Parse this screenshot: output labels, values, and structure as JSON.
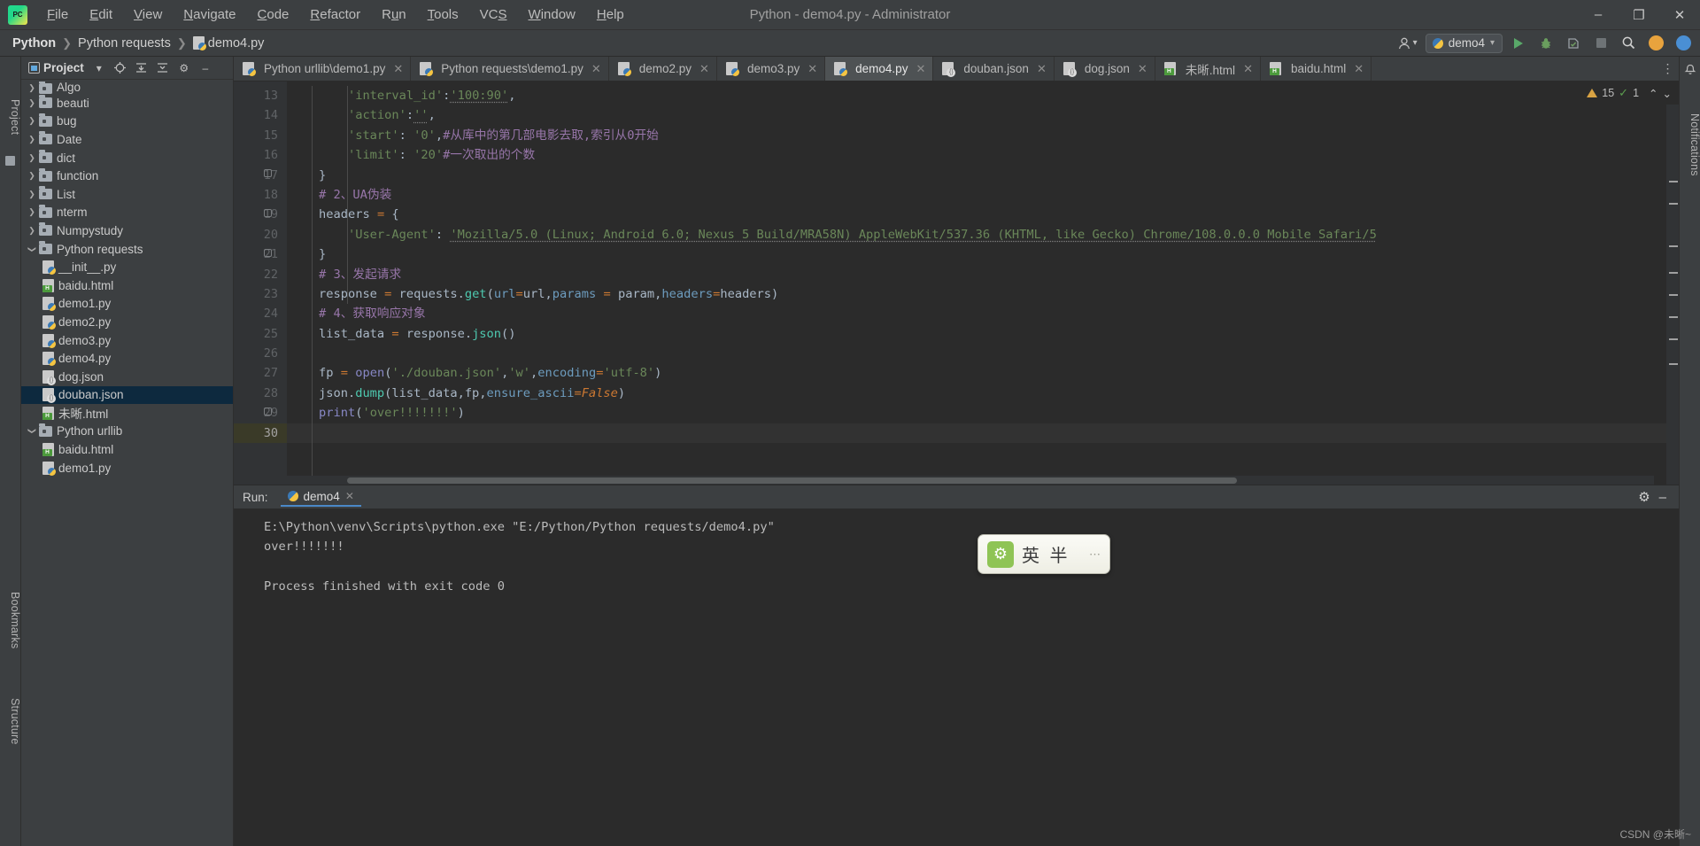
{
  "window": {
    "title": "Python - demo4.py - Administrator",
    "app_icon": "pycharm-logo",
    "minimize": "–",
    "maximize": "❐",
    "close": "✕"
  },
  "menu": {
    "items": [
      {
        "label": "File"
      },
      {
        "label": "Edit"
      },
      {
        "label": "View"
      },
      {
        "label": "Navigate"
      },
      {
        "label": "Code"
      },
      {
        "label": "Refactor"
      },
      {
        "label": "Run"
      },
      {
        "label": "Tools"
      },
      {
        "label": "VCS"
      },
      {
        "label": "Window"
      },
      {
        "label": "Help"
      }
    ]
  },
  "breadcrumb": {
    "project": "Python",
    "folder": "Python requests",
    "file": "demo4.py",
    "separator": "❯"
  },
  "toolbar": {
    "run_config": "demo4",
    "run_config_caret": "▾",
    "user_caret": "▾",
    "search_icon": "⌕",
    "run_tooltip": "Run",
    "debug_tooltip": "Debug",
    "coverage_tooltip": "Run with Coverage",
    "stop_tooltip": "Stop"
  },
  "sidebar": {
    "panel_title": "Project",
    "dropdown_caret": "▾",
    "left_tabs": [
      "Project",
      "Bookmarks",
      "Structure"
    ],
    "right_tabs": [
      "Notifications"
    ],
    "tree": [
      {
        "label": "Algo",
        "type": "folder",
        "indent": 0,
        "state": "collapsed",
        "partial": true
      },
      {
        "label": "beauti",
        "type": "folder",
        "indent": 0,
        "state": "collapsed"
      },
      {
        "label": "bug",
        "type": "folder",
        "indent": 0,
        "state": "collapsed"
      },
      {
        "label": "Date",
        "type": "folder",
        "indent": 0,
        "state": "collapsed"
      },
      {
        "label": "dict",
        "type": "folder",
        "indent": 0,
        "state": "collapsed"
      },
      {
        "label": "function",
        "type": "folder",
        "indent": 0,
        "state": "collapsed"
      },
      {
        "label": "List",
        "type": "folder",
        "indent": 0,
        "state": "collapsed"
      },
      {
        "label": "nterm",
        "type": "folder",
        "indent": 0,
        "state": "collapsed"
      },
      {
        "label": "Numpystudy",
        "type": "folder",
        "indent": 0,
        "state": "collapsed"
      },
      {
        "label": "Python requests",
        "type": "folder",
        "indent": 0,
        "state": "expanded"
      },
      {
        "label": "__init__.py",
        "type": "py",
        "indent": 1
      },
      {
        "label": "baidu.html",
        "type": "html",
        "indent": 1
      },
      {
        "label": "demo1.py",
        "type": "py",
        "indent": 1
      },
      {
        "label": "demo2.py",
        "type": "py",
        "indent": 1
      },
      {
        "label": "demo3.py",
        "type": "py",
        "indent": 1
      },
      {
        "label": "demo4.py",
        "type": "py",
        "indent": 1
      },
      {
        "label": "dog.json",
        "type": "json",
        "indent": 1
      },
      {
        "label": "douban.json",
        "type": "json",
        "indent": 1,
        "selected": true
      },
      {
        "label": "未晰.html",
        "type": "html",
        "indent": 1
      },
      {
        "label": "Python urllib",
        "type": "folder",
        "indent": 0,
        "state": "expanded"
      },
      {
        "label": "baidu.html",
        "type": "html",
        "indent": 1
      },
      {
        "label": "demo1.py",
        "type": "py",
        "indent": 1
      }
    ]
  },
  "editor": {
    "tabs": [
      {
        "label": "Python urllib\\demo1.py",
        "icon": "py",
        "active": false,
        "close": "✕"
      },
      {
        "label": "Python requests\\demo1.py",
        "icon": "py",
        "active": false,
        "close": "✕"
      },
      {
        "label": "demo2.py",
        "icon": "py",
        "active": false,
        "close": "✕"
      },
      {
        "label": "demo3.py",
        "icon": "py",
        "active": false,
        "close": "✕"
      },
      {
        "label": "demo4.py",
        "icon": "py",
        "active": true,
        "close": "✕"
      },
      {
        "label": "douban.json",
        "icon": "json",
        "active": false,
        "close": "✕"
      },
      {
        "label": "dog.json",
        "icon": "json",
        "active": false,
        "close": "✕"
      },
      {
        "label": "未晰.html",
        "icon": "html",
        "active": false,
        "close": "✕"
      },
      {
        "label": "baidu.html",
        "icon": "html",
        "active": false,
        "close": "✕"
      }
    ],
    "tab_overflow_icon": "⋮",
    "inspection": {
      "warnings": "15",
      "checks": "1",
      "warning_icon": "⚠",
      "check_icon": "✓",
      "up_caret": "⌃",
      "down_caret": "⌄"
    },
    "first_line_number": 13,
    "current_line": 30,
    "lines": [
      {
        "n": 13,
        "text": "        'interval_id':'100:90',"
      },
      {
        "n": 14,
        "text": "        'action':'',"
      },
      {
        "n": 15,
        "text": "        'start': '0',#从库中的第几部电影去取，索引从0开始"
      },
      {
        "n": 16,
        "text": "        'limit': '20'#一次取出的个数"
      },
      {
        "n": 17,
        "text": "    }"
      },
      {
        "n": 18,
        "text": "    # 2、UA伪装"
      },
      {
        "n": 19,
        "text": "    headers = {"
      },
      {
        "n": 20,
        "text": "        'User-Agent': 'Mozilla/5.0 (Linux; Android 6.0; Nexus 5 Build/MRA58N) AppleWebKit/537.36 (KHTML, like Gecko) Chrome/108.0.0.0 Mobile Safari/5"
      },
      {
        "n": 21,
        "text": "    }"
      },
      {
        "n": 22,
        "text": "    # 3、发起请求"
      },
      {
        "n": 23,
        "text": "    response = requests.get(url=url,params = param,headers=headers)"
      },
      {
        "n": 24,
        "text": "    # 4、获取响应对象"
      },
      {
        "n": 25,
        "text": "    list_data = response.json()"
      },
      {
        "n": 26,
        "text": ""
      },
      {
        "n": 27,
        "text": "    fp = open('./douban.json','w',encoding='utf-8')"
      },
      {
        "n": 28,
        "text": "    json.dump(list_data,fp,ensure_ascii=False)"
      },
      {
        "n": 29,
        "text": "    print('over!!!!!!!')"
      },
      {
        "n": 30,
        "text": ""
      }
    ]
  },
  "run_panel": {
    "label": "Run:",
    "tab_label": "demo4",
    "tab_close": "✕",
    "settings_icon": "⚙",
    "minimize_icon": "–",
    "output": [
      "E:\\Python\\venv\\Scripts\\python.exe \"E:/Python/Python requests/demo4.py\"",
      "over!!!!!!!",
      "",
      "Process finished with exit code 0"
    ]
  },
  "ime": {
    "mode_label": "英 半",
    "gear_icon": "⚙",
    "dots": "⋯"
  },
  "watermark": "CSDN @未晰~",
  "colors": {
    "background": "#3c3f41",
    "editor_bg": "#2b2b2b",
    "accent_blue": "#4a88c7",
    "selection": "#0d293e",
    "string_green": "#6a8759",
    "comment_purple": "#9876aa",
    "keyword_orange": "#cc7832",
    "number_blue": "#6897bb",
    "function_yellow": "#ffc66d"
  }
}
